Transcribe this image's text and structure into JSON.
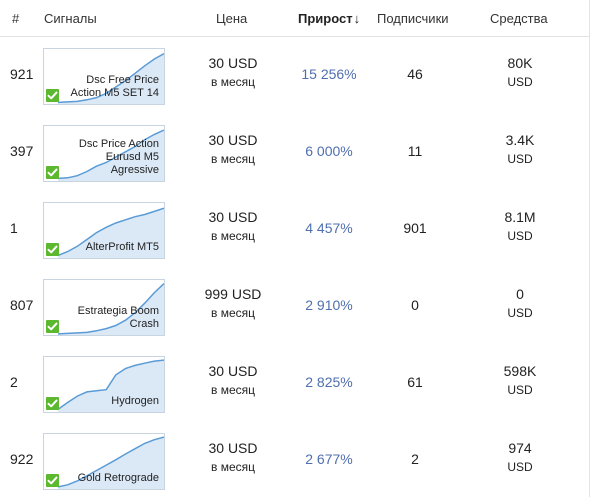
{
  "header": {
    "rank": "#",
    "signals": "Сигналы",
    "price": "Цена",
    "growth": "Прирост",
    "sort_arrow": "↓",
    "subscribers": "Подписчики",
    "funds": "Средства"
  },
  "rows": [
    {
      "rank": "921",
      "title_1": "Dsc Free Price",
      "title_2": "Action M5 SET 14",
      "title_3": "",
      "price": "30 USD",
      "period": "в месяц",
      "growth": "15 256%",
      "subscribers": "46",
      "funds": "80K",
      "currency": "USD",
      "chart_shape": [
        0.03,
        0.04,
        0.05,
        0.08,
        0.12,
        0.2,
        0.32,
        0.44,
        0.58,
        0.72,
        0.85,
        0.95
      ]
    },
    {
      "rank": "397",
      "title_1": "Dsc Price Action",
      "title_2": "Eurusd M5",
      "title_3": "Agressive",
      "price": "30 USD",
      "period": "в месяц",
      "growth": "6 000%",
      "subscribers": "11",
      "funds": "3.4K",
      "currency": "USD",
      "chart_shape": [
        0.05,
        0.06,
        0.1,
        0.18,
        0.28,
        0.35,
        0.45,
        0.55,
        0.65,
        0.78,
        0.88,
        0.96
      ]
    },
    {
      "rank": "1",
      "title_1": "AlterProfit MT5",
      "title_2": "",
      "title_3": "",
      "price": "30 USD",
      "period": "в месяц",
      "growth": "4 457%",
      "subscribers": "901",
      "funds": "8.1M",
      "currency": "USD",
      "chart_shape": [
        0.05,
        0.12,
        0.22,
        0.35,
        0.48,
        0.58,
        0.66,
        0.72,
        0.78,
        0.82,
        0.88,
        0.94
      ]
    },
    {
      "rank": "807",
      "title_1": "Estrategia Boom",
      "title_2": "Crash",
      "title_3": "",
      "price": "999 USD",
      "period": "в месяц",
      "growth": "2 910%",
      "subscribers": "0",
      "funds": "0",
      "currency": "USD",
      "chart_shape": [
        0.02,
        0.03,
        0.04,
        0.05,
        0.08,
        0.12,
        0.18,
        0.28,
        0.42,
        0.6,
        0.8,
        0.97
      ]
    },
    {
      "rank": "2",
      "title_1": "Hydrogen",
      "title_2": "",
      "title_3": "",
      "price": "30 USD",
      "period": "в месяц",
      "growth": "2 825%",
      "subscribers": "61",
      "funds": "598K",
      "currency": "USD",
      "chart_shape": [
        0.05,
        0.18,
        0.3,
        0.38,
        0.4,
        0.42,
        0.7,
        0.82,
        0.88,
        0.92,
        0.96,
        0.98
      ]
    },
    {
      "rank": "922",
      "title_1": "Gold Retrograde",
      "title_2": "",
      "title_3": "",
      "price": "30 USD",
      "period": "в месяц",
      "growth": "2 677%",
      "subscribers": "2",
      "funds": "974",
      "currency": "USD",
      "chart_shape": [
        0.04,
        0.08,
        0.15,
        0.25,
        0.35,
        0.45,
        0.55,
        0.66,
        0.76,
        0.86,
        0.93,
        0.98
      ]
    }
  ],
  "colors": {
    "chart_line": "#5a9bd5",
    "chart_fill": "#dbe9f7",
    "growth_text": "#4f6fb0",
    "check": "#5cb82e"
  }
}
